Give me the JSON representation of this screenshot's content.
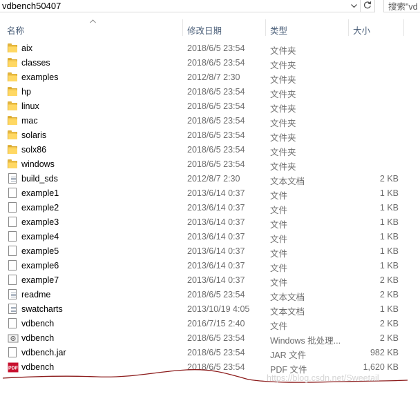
{
  "address": {
    "path": "vdbench50407",
    "search_placeholder": "搜索\"vd"
  },
  "columns": {
    "name": "名称",
    "date": "修改日期",
    "type": "类型",
    "size": "大小"
  },
  "files": [
    {
      "name": "aix",
      "date": "2018/6/5 23:54",
      "type": "文件夹",
      "size": "",
      "icon": "folder-icon"
    },
    {
      "name": "classes",
      "date": "2018/6/5 23:54",
      "type": "文件夹",
      "size": "",
      "icon": "folder-icon"
    },
    {
      "name": "examples",
      "date": "2012/8/7 2:30",
      "type": "文件夹",
      "size": "",
      "icon": "folder-icon"
    },
    {
      "name": "hp",
      "date": "2018/6/5 23:54",
      "type": "文件夹",
      "size": "",
      "icon": "folder-icon"
    },
    {
      "name": "linux",
      "date": "2018/6/5 23:54",
      "type": "文件夹",
      "size": "",
      "icon": "folder-icon"
    },
    {
      "name": "mac",
      "date": "2018/6/5 23:54",
      "type": "文件夹",
      "size": "",
      "icon": "folder-icon"
    },
    {
      "name": "solaris",
      "date": "2018/6/5 23:54",
      "type": "文件夹",
      "size": "",
      "icon": "folder-icon"
    },
    {
      "name": "solx86",
      "date": "2018/6/5 23:54",
      "type": "文件夹",
      "size": "",
      "icon": "folder-icon"
    },
    {
      "name": "windows",
      "date": "2018/6/5 23:54",
      "type": "文件夹",
      "size": "",
      "icon": "folder-icon"
    },
    {
      "name": "build_sds",
      "date": "2012/8/7 2:30",
      "type": "文本文档",
      "size": "2 KB",
      "icon": "text-document-icon"
    },
    {
      "name": "example1",
      "date": "2013/6/14 0:37",
      "type": "文件",
      "size": "1 KB",
      "icon": "file-icon"
    },
    {
      "name": "example2",
      "date": "2013/6/14 0:37",
      "type": "文件",
      "size": "1 KB",
      "icon": "file-icon"
    },
    {
      "name": "example3",
      "date": "2013/6/14 0:37",
      "type": "文件",
      "size": "1 KB",
      "icon": "file-icon"
    },
    {
      "name": "example4",
      "date": "2013/6/14 0:37",
      "type": "文件",
      "size": "1 KB",
      "icon": "file-icon"
    },
    {
      "name": "example5",
      "date": "2013/6/14 0:37",
      "type": "文件",
      "size": "1 KB",
      "icon": "file-icon"
    },
    {
      "name": "example6",
      "date": "2013/6/14 0:37",
      "type": "文件",
      "size": "1 KB",
      "icon": "file-icon"
    },
    {
      "name": "example7",
      "date": "2013/6/14 0:37",
      "type": "文件",
      "size": "2 KB",
      "icon": "file-icon"
    },
    {
      "name": "readme",
      "date": "2018/6/5 23:54",
      "type": "文本文档",
      "size": "2 KB",
      "icon": "text-document-icon"
    },
    {
      "name": "swatcharts",
      "date": "2013/10/19 4:05",
      "type": "文本文档",
      "size": "1 KB",
      "icon": "text-document-icon"
    },
    {
      "name": "vdbench",
      "date": "2016/7/15 2:40",
      "type": "文件",
      "size": "2 KB",
      "icon": "file-icon"
    },
    {
      "name": "vdbench",
      "date": "2018/6/5 23:54",
      "type": "Windows 批处理...",
      "size": "2 KB",
      "icon": "batch-file-icon"
    },
    {
      "name": "vdbench.jar",
      "date": "2018/6/5 23:54",
      "type": "JAR 文件",
      "size": "982 KB",
      "icon": "file-icon"
    },
    {
      "name": "vdbench",
      "date": "2018/6/5 23:54",
      "type": "PDF 文件",
      "size": "1,620 KB",
      "icon": "pdf-icon"
    }
  ],
  "watermark": "https://blog.csdn.net/Sweetail"
}
